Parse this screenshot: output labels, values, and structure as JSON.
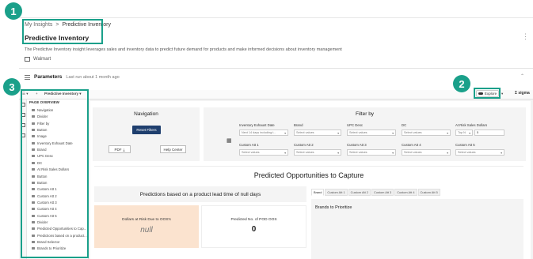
{
  "breadcrumb": {
    "root": "My Insights",
    "separator": ">",
    "current": "Predictive Inventory"
  },
  "page_title": "Predictive Inventory",
  "description": "The Predictive Inventory insight leverages sales and inventory data to predict future demand for products and make informed decisions about inventory management",
  "retailer": "Walmart",
  "parameters": {
    "title": "Parameters",
    "subtitle": "Last run about 1 month ago"
  },
  "callouts": [
    "1",
    "2",
    "3"
  ],
  "toolbar": {
    "workbook_name": "Predictive Inventory",
    "explore_label": "Explore",
    "brand": "sigma"
  },
  "sidebar": {
    "heading": "PAGE OVERVIEW",
    "items": [
      "Navigation",
      "Divider",
      "Filter by",
      "Button",
      "Image",
      "Inventory Exhaust Date",
      "Brand",
      "UPC Desc",
      "DC",
      "At Risk Sales Dollars",
      "Button",
      "Button",
      "Custom Att 1",
      "Custom Att 2",
      "Custom Att 3",
      "Custom Att 4",
      "Custom Att 5",
      "Divider",
      "Predicted Opportunities to Cap...",
      "Predictions based on a product...",
      "Brand Selector",
      "Brands to Prioritize"
    ]
  },
  "navigation": {
    "title": "Navigation",
    "reset_label": "Reset Filters",
    "pdf_label": "PDF",
    "help_label": "Help Center"
  },
  "filters": {
    "title": "Filter by",
    "row1": [
      {
        "label": "Inventory Exhaust Date",
        "value": "Next 14 days including t..."
      },
      {
        "label": "Brand",
        "value": "Select values"
      },
      {
        "label": "UPC Desc",
        "value": "Select values"
      },
      {
        "label": "DC",
        "value": "Select values"
      },
      {
        "label": "At Risk Sales Dollars",
        "value": "Top N",
        "value2": "5"
      }
    ],
    "row2": [
      {
        "label": "Custom Att 1",
        "value": "Select values"
      },
      {
        "label": "Custom Att 2",
        "value": "Select values"
      },
      {
        "label": "Custom Att 3",
        "value": "Select values"
      },
      {
        "label": "Custom Att 4",
        "value": "Select values"
      },
      {
        "label": "Custom Att 5",
        "value": "Select values"
      }
    ]
  },
  "section_title": "Predicted Opportunities to Capture",
  "predictions_label": "Predictions based on a product lead time of null days",
  "kpis": [
    {
      "label": "Dollars at Risk Due to OOS's",
      "value": "null"
    },
    {
      "label": "Predicted No. of POD OOS",
      "value": "0"
    }
  ],
  "tabs": [
    "Brand",
    "Custom Att 1",
    "Custom Att 2",
    "Custom Att 3",
    "Custom Att 4",
    "Custom Att 5"
  ],
  "brands_panel_title": "Brands to Prioritize",
  "colors": {
    "accent": "#1aa08a",
    "reset_button": "#1f3f6e",
    "kpi_highlight": "#fbe3cf"
  }
}
